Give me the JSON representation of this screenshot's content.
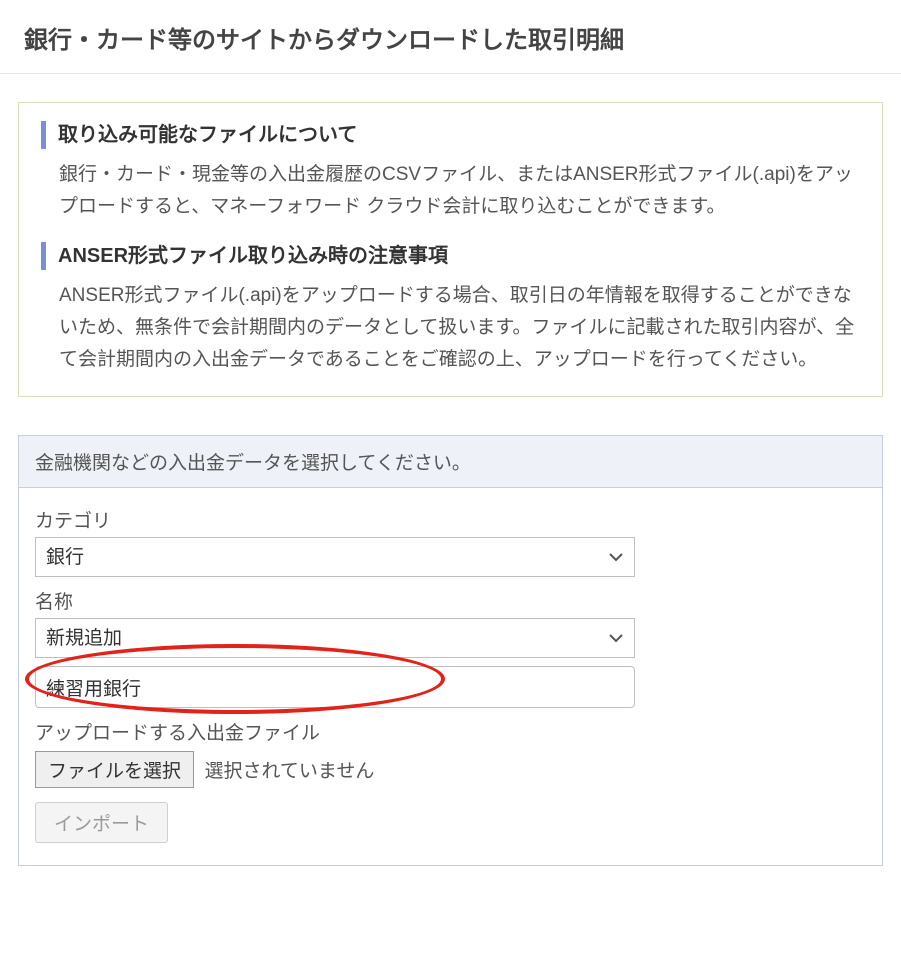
{
  "page": {
    "title": "銀行・カード等のサイトからダウンロードした取引明細"
  },
  "info": {
    "section1": {
      "heading": "取り込み可能なファイルについて",
      "body": "銀行・カード・現金等の入出金履歴のCSVファイル、またはANSER形式ファイル(.api)をアップロードすると、マネーフォワード クラウド会計に取り込むことができます。"
    },
    "section2": {
      "heading": "ANSER形式ファイル取り込み時の注意事項",
      "body": "ANSER形式ファイル(.api)をアップロードする場合、取引日の年情報を取得することができないため、無条件で会計期間内のデータとして扱います。ファイルに記載された取引内容が、全て会計期間内の入出金データであることをご確認の上、アップロードを行ってください。"
    }
  },
  "form": {
    "header": "金融機関などの入出金データを選択してください。",
    "category": {
      "label": "カテゴリ",
      "selected": "銀行"
    },
    "name": {
      "label": "名称",
      "selected": "新規追加",
      "input_value": "練習用銀行"
    },
    "upload": {
      "label": "アップロードする入出金ファイル",
      "button": "ファイルを選択",
      "status": "選択されていません"
    },
    "import_button": "インポート"
  }
}
